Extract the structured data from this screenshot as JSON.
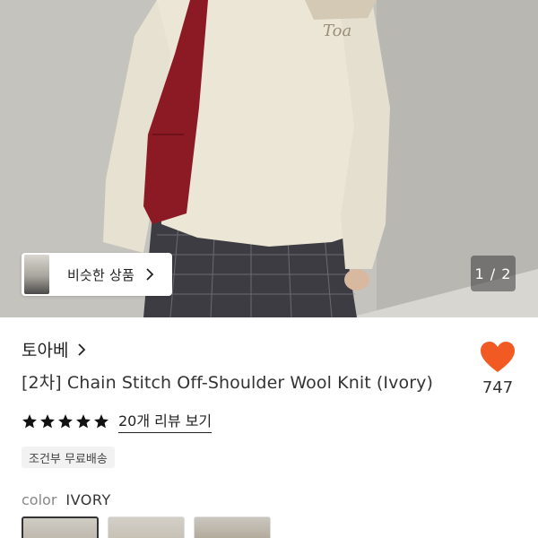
{
  "hero": {
    "similar_label": "비슷한 상품",
    "pager": "1 / 2"
  },
  "product": {
    "brand": "토아베",
    "title": "[2차] Chain Stitch Off-Shoulder Wool Knit (Ivory)",
    "like_count": "747",
    "rating_stars": 5,
    "review_link": "20개 리뷰 보기",
    "shipping_badge": "조건부 무료배송",
    "color_label": "color",
    "color_value": "IVORY",
    "embroidery_text": "Toa"
  },
  "colors": {
    "heart": "#f15a22",
    "star": "#111111",
    "skirt": "#3c3c42",
    "sweater": "#ebe6d6",
    "bag": "#8c1a24"
  },
  "icons": [
    "chevron-right-icon",
    "heart-icon",
    "star-icon"
  ]
}
